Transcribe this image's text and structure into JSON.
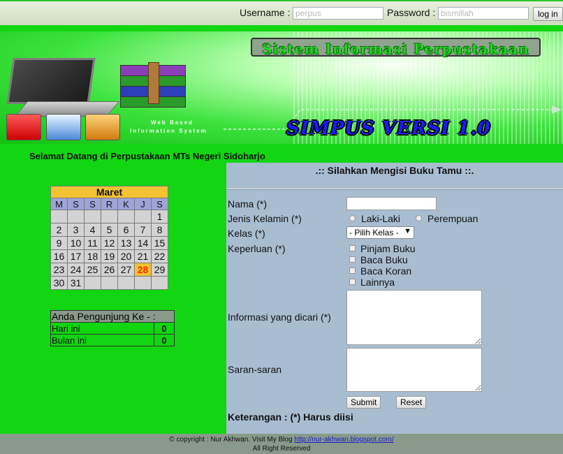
{
  "login": {
    "username_label": "Username :",
    "username_placeholder": "perpus",
    "password_label": "Password :",
    "password_placeholder": "bismillah",
    "login_button": "log in"
  },
  "banner": {
    "title": "Sistem Informasi Perpustakaan",
    "product": "SIMPUS VERSI 1.0",
    "tagline_1": "Web Based",
    "tagline_2": "Information System"
  },
  "welcome": "Selamat Datang di Perpustakaan MTs Negeri Sidoharjo",
  "calendar": {
    "month": "Maret",
    "days": [
      "M",
      "S",
      "S",
      "R",
      "K",
      "J",
      "S"
    ],
    "weeks": [
      [
        "",
        "",
        "",
        "",
        "",
        "",
        "1"
      ],
      [
        "2",
        "3",
        "4",
        "5",
        "6",
        "7",
        "8"
      ],
      [
        "9",
        "10",
        "11",
        "12",
        "13",
        "14",
        "15"
      ],
      [
        "16",
        "17",
        "18",
        "19",
        "20",
        "21",
        "22"
      ],
      [
        "23",
        "24",
        "25",
        "26",
        "27",
        "28",
        "29"
      ],
      [
        "30",
        "31",
        "",
        "",
        "",
        "",
        ""
      ]
    ],
    "today": "28"
  },
  "visitors": {
    "header": "Anda Pengunjung Ke - :",
    "rows": [
      {
        "label": "Hari ini",
        "value": "0"
      },
      {
        "label": "Bulan ini",
        "value": "0"
      }
    ]
  },
  "form": {
    "title": ".:: Silahkan Mengisi Buku Tamu ::.",
    "nama_label": "Nama (*)",
    "gender_label": "Jenis Kelamin (*)",
    "gender_options": [
      "Laki-Laki",
      "Perempuan"
    ],
    "kelas_label": "Kelas (*)",
    "kelas_selected": "- Pilih Kelas -",
    "keperluan_label": "Keperluan (*)",
    "keperluan_options": [
      "Pinjam Buku",
      "Baca Buku",
      "Baca Koran",
      "Lainnya"
    ],
    "info_label": "Informasi yang dicari (*)",
    "saran_label": "Saran-saran",
    "submit": "Submit",
    "reset": "Reset",
    "note": "Keterangan : (*) Harus diisi"
  },
  "footer": {
    "copyright": "© copyright : Nur Akhwan.  Visit My Blog ",
    "blog_link": "http://nur-akhwan.blogspot.com/",
    "rights": "All Right Reserved"
  },
  "colors": {
    "green": "#11d611",
    "form_bg": "#a9bdd1",
    "calendar_head": "#f3c334",
    "calendar_days": "#9ea4d8",
    "today": "#ff2a00"
  }
}
